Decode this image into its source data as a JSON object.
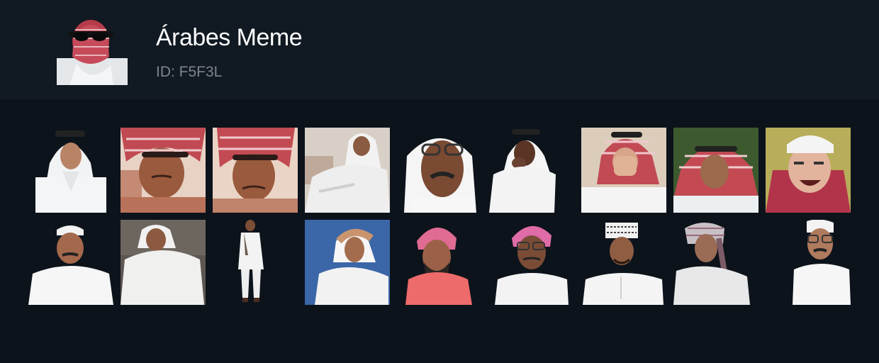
{
  "pack": {
    "title": "Árabes Meme",
    "id_label": "ID: F5F3L",
    "thumbnail": "man-red-keffiyeh-sunglasses"
  },
  "stickers": [
    "young-man-white-ghutra",
    "man-red-shemagh-eyes-closed",
    "man-red-shemagh-frowning",
    "man-white-ghutra-reclining",
    "old-man-glasses-white-ghutra",
    "old-man-hand-on-mouth",
    "man-covering-face-red-shemagh",
    "man-laughing-red-shemagh",
    "man-white-cap-laughing",
    "man-white-kufi-portrait",
    "man-white-thobe-hand-on-chin",
    "man-full-body-white-kurta",
    "man-holding-head-blue-background",
    "man-pink-turban-beard",
    "man-pink-turban-glasses",
    "young-man-omani-kumma",
    "old-man-grey-turban",
    "man-white-cap-glasses"
  ],
  "colors": {
    "header_bg": "#111922",
    "page_bg": "#0c131b",
    "title": "#ffffff",
    "subtitle": "#7d848c"
  }
}
